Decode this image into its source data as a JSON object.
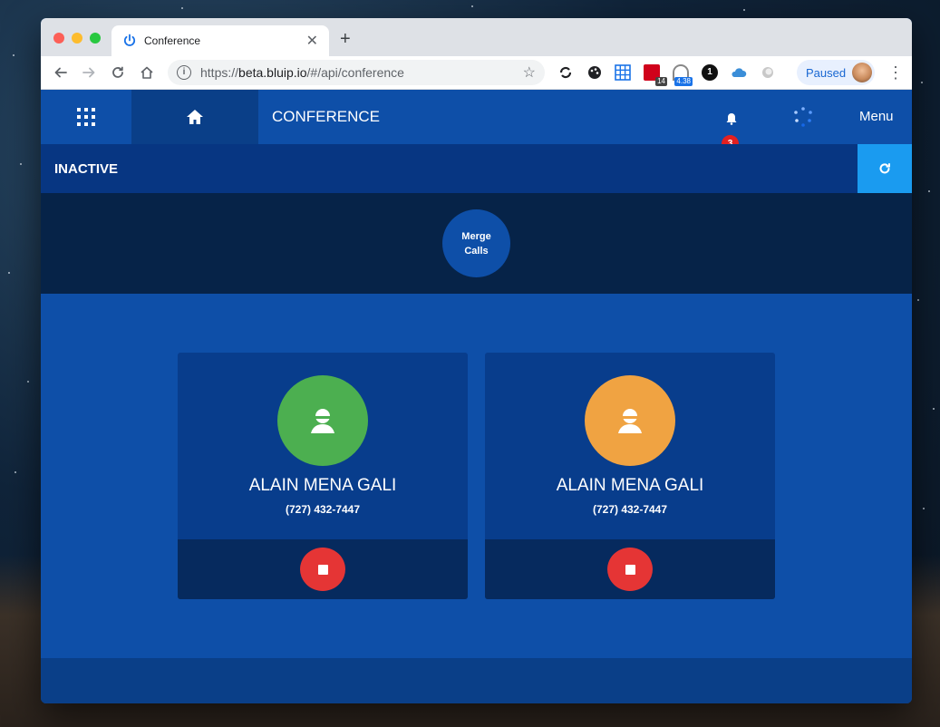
{
  "browser": {
    "tab_title": "Conference",
    "url_prefix": "https://",
    "url_host": "beta.bluip.io",
    "url_path": "/#/api/conference",
    "paused_label": "Paused",
    "extensions": [
      {
        "name": "sync-icon",
        "badge": ""
      },
      {
        "name": "palette-icon",
        "badge": ""
      },
      {
        "name": "grid-icon",
        "badge": ""
      },
      {
        "name": "calendar-extension-icon",
        "badge": "14"
      },
      {
        "name": "gauge-extension-icon",
        "badge": "4.38"
      },
      {
        "name": "onepassword-icon",
        "badge": "1"
      },
      {
        "name": "cloud-icon",
        "badge": ""
      },
      {
        "name": "circle-extension-icon",
        "badge": ""
      }
    ]
  },
  "app": {
    "title": "CONFERENCE",
    "notifications_count": "3",
    "menu_label": "Menu",
    "status": "INACTIVE",
    "merge_label_line1": "Merge",
    "merge_label_line2": "Calls",
    "colors": {
      "primary": "#0e4fa8",
      "dark": "#062348",
      "accent": "#1a9bf0",
      "hangup": "#e53535",
      "avatar_green": "#4caf50",
      "avatar_orange": "#f0a342"
    },
    "participants": [
      {
        "name": "ALAIN MENA GALI",
        "phone": "(727) 432-7447",
        "avatar_color": "#4caf50"
      },
      {
        "name": "ALAIN MENA GALI",
        "phone": "(727) 432-7447",
        "avatar_color": "#f0a342"
      }
    ]
  }
}
